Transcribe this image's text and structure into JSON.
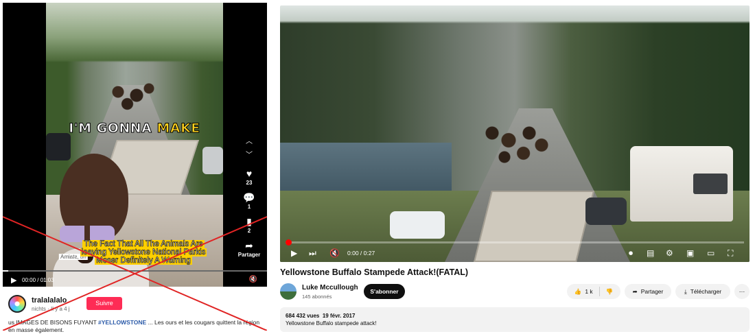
{
  "left": {
    "caption_big_prefix": "I'M GONNA ",
    "caption_big_highlight": "MAKE",
    "caption_yellow": "The Fact That All The Animals Are leaving Yellowstone National Parkis Moser Definitely A Warning",
    "mirror_sticker": "nu ,staimA",
    "actions": {
      "likes": "23",
      "comments": "1",
      "saves": "2",
      "share_label": "Partager"
    },
    "progress": 0.02,
    "time": "00:00 / 01:03",
    "username": "tralalalalo",
    "user_sub": "nichts · Il y a 4 j",
    "follow_label": "Suivre",
    "description_prefix": "us IMAGES DE BISONS FUYANT ",
    "description_tag": "#YELLOWSTONE",
    "description_suffix": " ... Les ours et les cougars quittent la région en masse également.",
    "cross_color": "#e02424"
  },
  "right": {
    "time": "0:00 / 0:27",
    "progress": 0.0,
    "title": "Yellowstone Buffalo Stampede Attack!(FATAL)",
    "channel_name": "Luke Mccullough",
    "channel_subs": "145 abonnés",
    "subscribe_label": "S'abonner",
    "likes": "1 k",
    "share_label": "Partager",
    "download_label": "Télécharger",
    "views": "684 432 vues",
    "date": "19 févr. 2017",
    "description": "Yellowstone Buffalo stampede attack!",
    "accent_color": "#ff0000"
  }
}
